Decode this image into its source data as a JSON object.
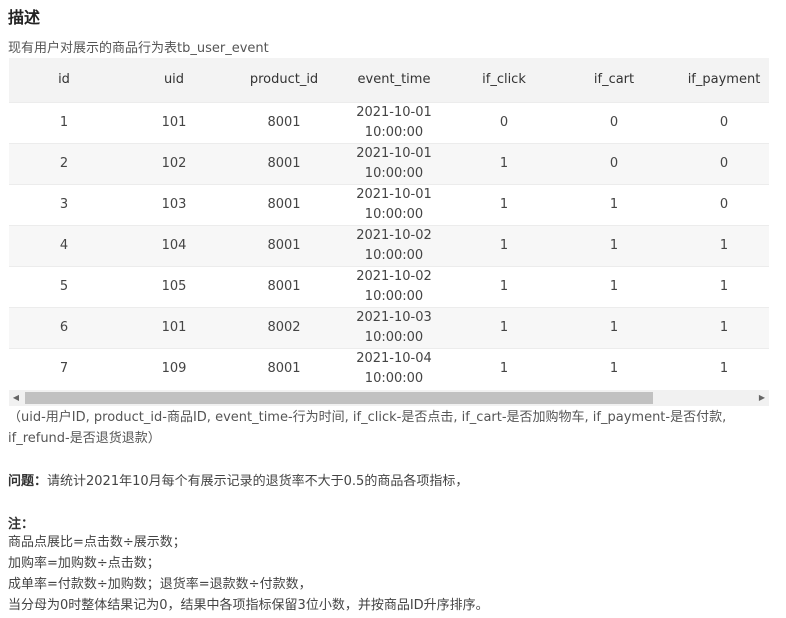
{
  "title": "描述",
  "intro": "现有用户对展示的商品行为表tb_user_event",
  "table": {
    "headers": [
      "id",
      "uid",
      "product_id",
      "event_time",
      "if_click",
      "if_cart",
      "if_payment"
    ],
    "rows": [
      {
        "id": "1",
        "uid": "101",
        "product_id": "8001",
        "date": "2021-10-01",
        "time": "10:00:00",
        "if_click": "0",
        "if_cart": "0",
        "if_payment": "0"
      },
      {
        "id": "2",
        "uid": "102",
        "product_id": "8001",
        "date": "2021-10-01",
        "time": "10:00:00",
        "if_click": "1",
        "if_cart": "0",
        "if_payment": "0"
      },
      {
        "id": "3",
        "uid": "103",
        "product_id": "8001",
        "date": "2021-10-01",
        "time": "10:00:00",
        "if_click": "1",
        "if_cart": "1",
        "if_payment": "0"
      },
      {
        "id": "4",
        "uid": "104",
        "product_id": "8001",
        "date": "2021-10-02",
        "time": "10:00:00",
        "if_click": "1",
        "if_cart": "1",
        "if_payment": "1"
      },
      {
        "id": "5",
        "uid": "105",
        "product_id": "8001",
        "date": "2021-10-02",
        "time": "10:00:00",
        "if_click": "1",
        "if_cart": "1",
        "if_payment": "1"
      },
      {
        "id": "6",
        "uid": "101",
        "product_id": "8002",
        "date": "2021-10-03",
        "time": "10:00:00",
        "if_click": "1",
        "if_cart": "1",
        "if_payment": "1"
      },
      {
        "id": "7",
        "uid": "109",
        "product_id": "8001",
        "date": "2021-10-04",
        "time": "10:00:00",
        "if_click": "1",
        "if_cart": "1",
        "if_payment": "1"
      }
    ]
  },
  "scrollbar": {
    "left_arrow": "◀",
    "right_arrow": "▶"
  },
  "note_line1": "（uid-用户ID, product_id-商品ID, event_time-行为时间, if_click-是否点击, if_cart-是否加购物车, if_payment-是否付款,",
  "note_line2": "if_refund-是否退货退款）",
  "question_label": "问题：",
  "question_text": "请统计2021年10月每个有展示记录的退货率不大于0.5的商品各项指标，",
  "notes_title": "注：",
  "notes_lines": [
    "商品点展比=点击数÷展示数；",
    "加购率=加购数÷点击数；",
    "成单率=付款数÷加购数；退货率=退款数÷付款数，",
    "当分母为0时整体结果记为0，结果中各项指标保留3位小数，并按商品ID升序排序。"
  ]
}
